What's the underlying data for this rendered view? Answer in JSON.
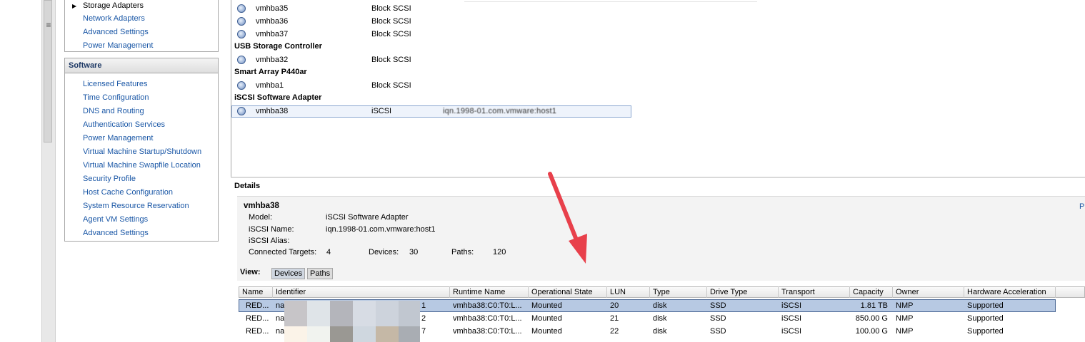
{
  "hardware_nav": {
    "storage_adapters": "Storage Adapters",
    "items": [
      "Network Adapters",
      "Advanced Settings",
      "Power Management"
    ]
  },
  "software_nav": {
    "title": "Software",
    "items": [
      "Licensed Features",
      "Time Configuration",
      "DNS and Routing",
      "Authentication Services",
      "Power Management",
      "Virtual Machine Startup/Shutdown",
      "Virtual Machine Swapfile Location",
      "Security Profile",
      "Host Cache Configuration",
      "System Resource Reservation",
      "Agent VM Settings",
      "Advanced Settings"
    ]
  },
  "adapters": {
    "rows": [
      {
        "name": "vmhba35",
        "type": "Block SCSI"
      },
      {
        "name": "vmhba36",
        "type": "Block SCSI"
      },
      {
        "name": "vmhba37",
        "type": "Block SCSI"
      }
    ],
    "groups": [
      {
        "title": "USB Storage Controller",
        "rows": [
          {
            "name": "vmhba32",
            "type": "Block SCSI"
          }
        ]
      },
      {
        "title": "Smart Array P440ar",
        "rows": [
          {
            "name": "vmhba1",
            "type": "Block SCSI"
          }
        ]
      },
      {
        "title": "iSCSI Software Adapter",
        "rows": [
          {
            "name": "vmhba38",
            "type": "iSCSI",
            "identifier": "iqn.1998-01.com.vmware:host1"
          }
        ]
      }
    ]
  },
  "details": {
    "label": "Details",
    "adapter_name": "vmhba38",
    "model_label": "Model:",
    "model_value": "iSCSI Software Adapter",
    "iscsi_name_label": "iSCSI Name:",
    "iscsi_name_value": "iqn.1998-01.com.vmware:host1",
    "alias_label": "iSCSI Alias:",
    "targets_label": "Connected Targets:",
    "targets_value": "4",
    "devices_label": "Devices:",
    "devices_value": "30",
    "paths_label": "Paths:",
    "paths_value": "120",
    "right_link": "Pr"
  },
  "view": {
    "label": "View:",
    "devices_button": "Devices",
    "paths_button": "Paths"
  },
  "device_table": {
    "columns": [
      "Name",
      "Identifier",
      "Runtime Name",
      "Operational State",
      "LUN",
      "Type",
      "Drive Type",
      "Transport",
      "Capacity",
      "Owner",
      "Hardware Acceleration"
    ],
    "rows": [
      {
        "name": "RED...",
        "identifier": "na",
        "id_tail": "1",
        "runtime": "vmhba38:C0:T0:L...",
        "state": "Mounted",
        "lun": "20",
        "type": "disk",
        "drive": "SSD",
        "transport": "iSCSI",
        "capacity": "1.81 TB",
        "owner": "NMP",
        "hw": "Supported"
      },
      {
        "name": "RED...",
        "identifier": "na",
        "id_tail": "2",
        "runtime": "vmhba38:C0:T0:L...",
        "state": "Mounted",
        "lun": "21",
        "type": "disk",
        "drive": "SSD",
        "transport": "iSCSI",
        "capacity": "850.00 G",
        "owner": "NMP",
        "hw": "Supported"
      },
      {
        "name": "RED...",
        "identifier": "na",
        "id_tail": "7",
        "runtime": "vmhba38:C0:T0:L...",
        "state": "Mounted",
        "lun": "22",
        "type": "disk",
        "drive": "SSD",
        "transport": "iSCSI",
        "capacity": "100.00 G",
        "owner": "NMP",
        "hw": "Supported"
      }
    ]
  },
  "colors": {
    "link": "#1a57a6",
    "selection": "#b7c9e3",
    "arrow": "#e8404b"
  }
}
